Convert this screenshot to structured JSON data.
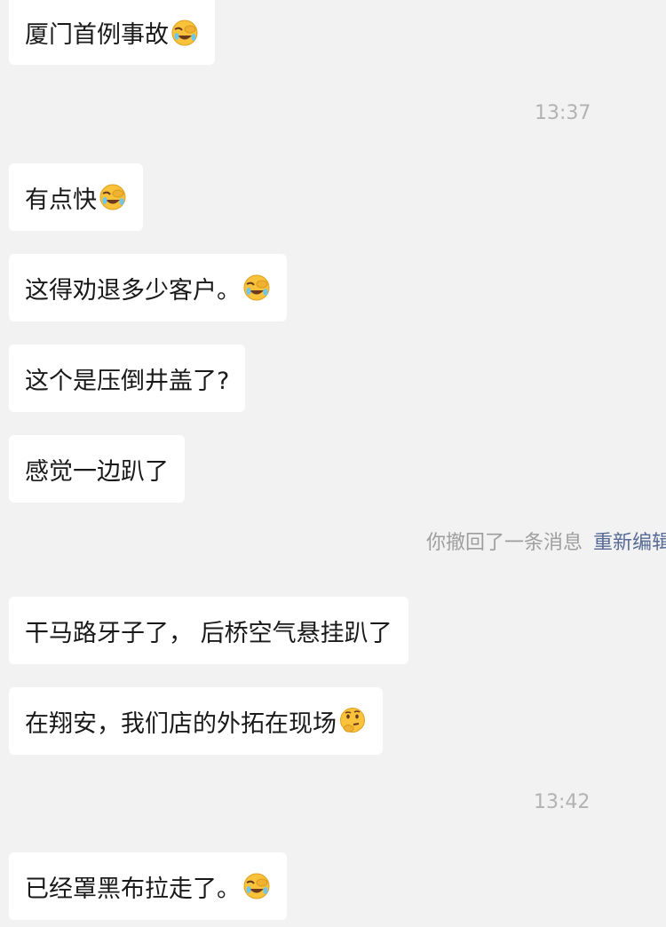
{
  "messages": [
    {
      "text": "厦门首例事故",
      "emoji": "facepalm-laugh-emoji"
    },
    {
      "text": "有点快",
      "emoji": "facepalm-laugh-emoji"
    },
    {
      "text": "这得劝退多少客户。",
      "emoji": "facepalm-laugh-emoji"
    },
    {
      "text": "这个是压倒井盖了?"
    },
    {
      "text": "感觉一边趴了"
    },
    {
      "text": "干马路牙子了， 后桥空气悬挂趴了"
    },
    {
      "text": "在翔安，我们店的外拓在现场",
      "emoji": "thinking-face-emoji"
    },
    {
      "text": "已经罩黑布拉走了。",
      "emoji": "facepalm-laugh-emoji"
    }
  ],
  "timestamps": [
    "13:37",
    "13:42"
  ],
  "system_notice": {
    "text": "你撤回了一条消息",
    "action": "重新编辑"
  },
  "colors": {
    "background": "#f2f2f2",
    "bubble": "#ffffff",
    "link": "#576b95",
    "timestamp": "#b2b2b2"
  }
}
